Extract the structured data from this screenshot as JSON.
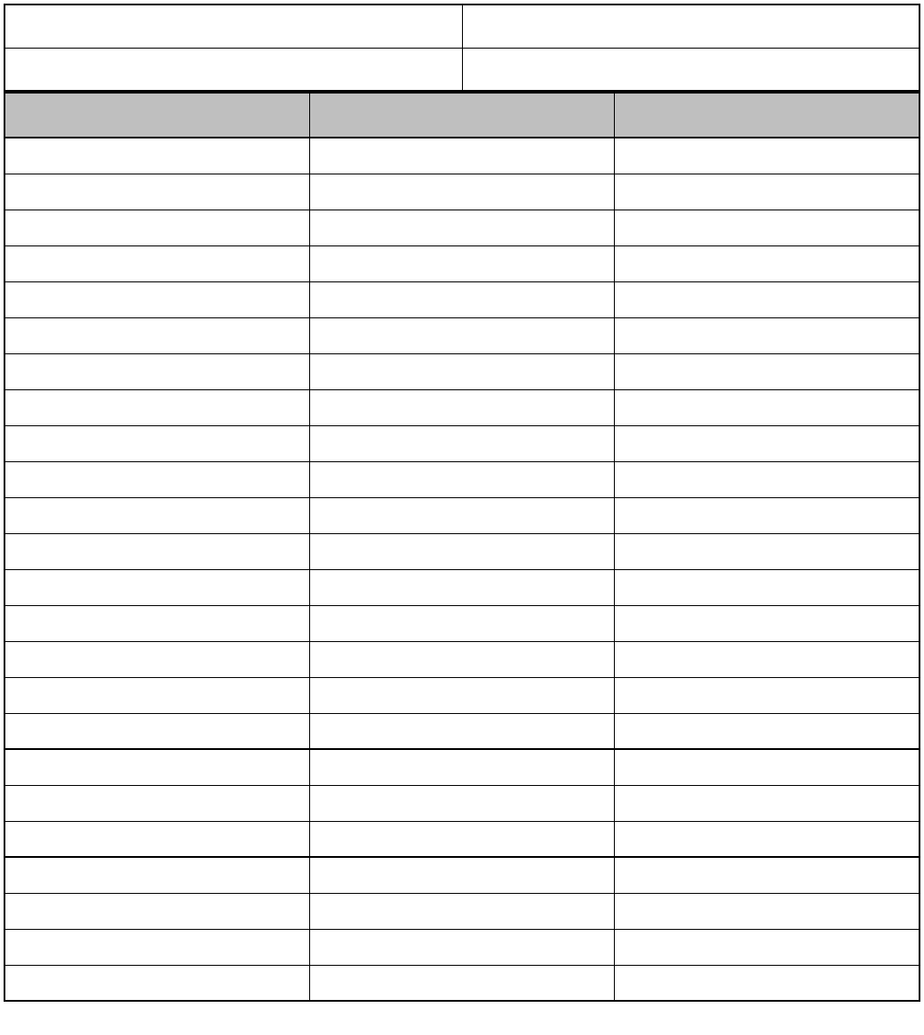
{
  "meta": {
    "top_left": "",
    "top_right": "",
    "bottom_left": "",
    "bottom_right": ""
  },
  "table": {
    "headers": [
      "",
      "",
      ""
    ],
    "sections": [
      {
        "rows": [
          [
            "",
            "",
            ""
          ],
          [
            "",
            "",
            ""
          ],
          [
            "",
            "",
            ""
          ],
          [
            "",
            "",
            ""
          ],
          [
            "",
            "",
            ""
          ],
          [
            "",
            "",
            ""
          ],
          [
            "",
            "",
            ""
          ],
          [
            "",
            "",
            ""
          ],
          [
            "",
            "",
            ""
          ],
          [
            "",
            "",
            ""
          ],
          [
            "",
            "",
            ""
          ],
          [
            "",
            "",
            ""
          ],
          [
            "",
            "",
            ""
          ],
          [
            "",
            "",
            ""
          ],
          [
            "",
            "",
            ""
          ],
          [
            "",
            "",
            ""
          ],
          [
            "",
            "",
            ""
          ]
        ]
      },
      {
        "rows": [
          [
            "",
            "",
            ""
          ],
          [
            "",
            "",
            ""
          ],
          [
            "",
            "",
            ""
          ]
        ]
      },
      {
        "rows": [
          [
            "",
            "",
            ""
          ],
          [
            "",
            "",
            ""
          ],
          [
            "",
            "",
            ""
          ],
          [
            "",
            "",
            ""
          ]
        ]
      }
    ]
  }
}
